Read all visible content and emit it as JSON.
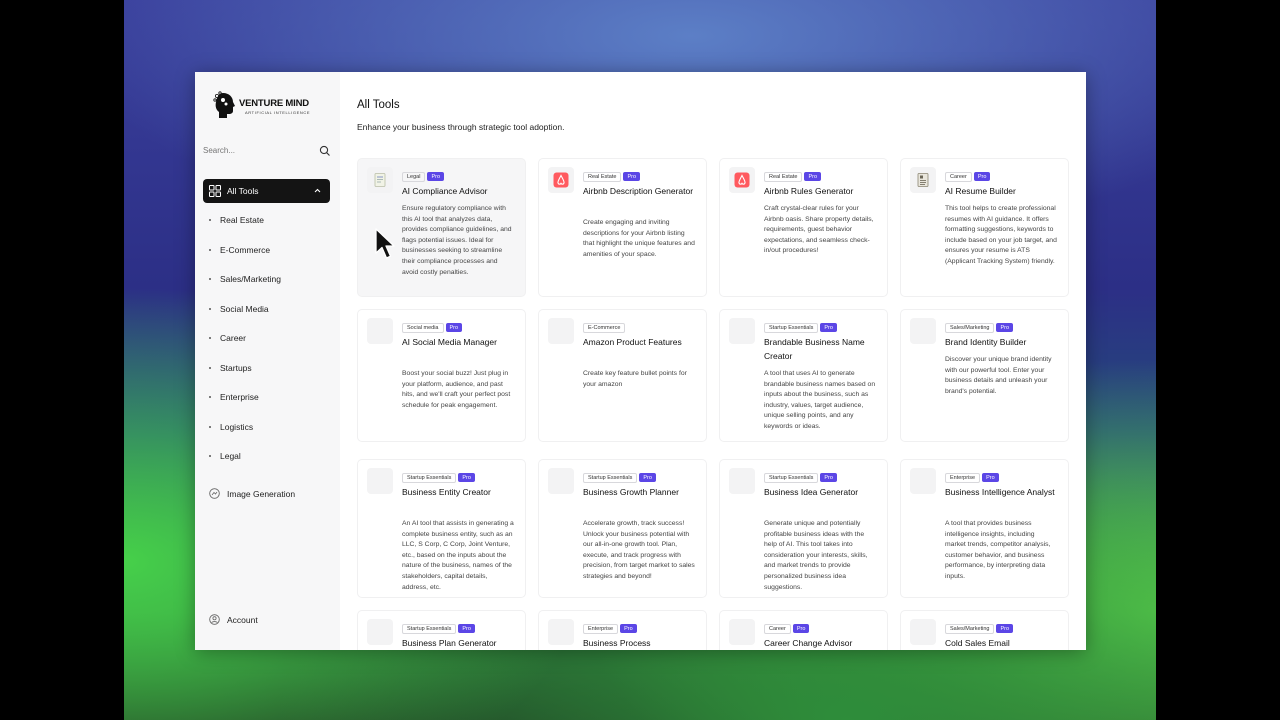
{
  "app": {
    "logo_name": "VENTURE MIND",
    "logo_tagline": "ARTIFICIAL INTELLIGENCE"
  },
  "sidebar": {
    "search_placeholder": "Search...",
    "active_item": "All Tools",
    "categories": [
      "Real Estate",
      "E-Commerce",
      "Sales/Marketing",
      "Social Media",
      "Career",
      "Startups",
      "Enterprise",
      "Logistics",
      "Legal"
    ],
    "image_generation": "Image Generation",
    "account": "Account"
  },
  "main": {
    "title": "All Tools",
    "subtitle": "Enhance your business through strategic tool adoption.",
    "pro_label": "Pro",
    "cards": [
      {
        "tag": "Legal",
        "pro": true,
        "icon": "document-icon",
        "title": "AI Compliance Advisor",
        "desc": "Ensure regulatory compliance with this AI tool that analyzes data, provides compliance guidelines, and flags potential issues. Ideal for businesses seeking to streamline their compliance processes and avoid costly penalties."
      },
      {
        "tag": "Real Estate",
        "pro": true,
        "icon": "airbnb-icon",
        "title": "Airbnb Description Generator",
        "desc": "Create engaging and inviting descriptions for your Airbnb listing that highlight the unique features and amenities of your space."
      },
      {
        "tag": "Real Estate",
        "pro": true,
        "icon": "airbnb-icon",
        "title": "Airbnb Rules Generator",
        "desc": "Craft crystal-clear rules for your Airbnb oasis. Share property details, requirements, guest behavior expectations, and seamless check-in/out procedures!"
      },
      {
        "tag": "Career",
        "pro": true,
        "icon": "resume-icon",
        "title": "AI Resume Builder",
        "desc": "This tool helps to create professional resumes with AI guidance. It offers formatting suggestions, keywords to include based on your job target, and ensures your resume is ATS (Applicant Tracking System) friendly."
      },
      {
        "tag": "Social media",
        "pro": true,
        "icon": "placeholder-icon",
        "title": "AI Social Media Manager",
        "desc": "Boost your social buzz! Just plug in your platform, audience, and past hits, and we'll craft your perfect post schedule for peak engagement."
      },
      {
        "tag": "E-Commerce",
        "pro": false,
        "icon": "placeholder-icon",
        "title": "Amazon Product Features",
        "desc": "Create key feature bullet points for your amazon"
      },
      {
        "tag": "Startup Essentials",
        "pro": true,
        "icon": "placeholder-icon",
        "title": "Brandable Business Name Creator",
        "desc": "A tool that uses AI to generate brandable business names based on inputs about the business, such as industry, values, target audience, unique selling points, and any keywords or ideas."
      },
      {
        "tag": "Sales/Marketing",
        "pro": true,
        "icon": "placeholder-icon",
        "title": "Brand Identity Builder",
        "desc": "Discover your unique brand identity with our powerful tool. Enter your business details and unleash your brand's potential."
      },
      {
        "tag": "Startup Essentials",
        "pro": true,
        "icon": "placeholder-icon",
        "title": "Business Entity Creator",
        "desc": "An AI tool that assists in generating a complete business entity, such as an LLC, S Corp, C Corp, Joint Venture, etc., based on the inputs about the nature of the business, names of the stakeholders, capital details, address, etc."
      },
      {
        "tag": "Startup Essentials",
        "pro": true,
        "icon": "placeholder-icon",
        "title": "Business Growth Planner",
        "desc": "Accelerate growth, track success! Unlock your business potential with our all-in-one growth tool. Plan, execute, and track progress with precision, from target market to sales strategies and beyond!"
      },
      {
        "tag": "Startup Essentials",
        "pro": true,
        "icon": "placeholder-icon",
        "title": "Business Idea Generator",
        "desc": "Generate unique and potentially profitable business ideas with the help of AI. This tool takes into consideration your interests, skills, and market trends to provide personalized business idea suggestions."
      },
      {
        "tag": "Enterprise",
        "pro": true,
        "icon": "placeholder-icon",
        "title": "Business Intelligence Analyst",
        "desc": "A tool that provides business intelligence insights, including market trends, competitor analysis, customer behavior, and business performance, by interpreting data inputs."
      },
      {
        "tag": "Startup Essentials",
        "pro": true,
        "icon": "placeholder-icon",
        "title": "Business Plan Generator",
        "desc": ""
      },
      {
        "tag": "Enterprise",
        "pro": true,
        "icon": "placeholder-icon",
        "title": "Business Process",
        "desc": ""
      },
      {
        "tag": "Career",
        "pro": true,
        "icon": "placeholder-icon",
        "title": "Career Change Advisor",
        "desc": ""
      },
      {
        "tag": "Sales/Marketing",
        "pro": true,
        "icon": "placeholder-icon",
        "title": "Cold Sales Email",
        "desc": ""
      }
    ]
  }
}
